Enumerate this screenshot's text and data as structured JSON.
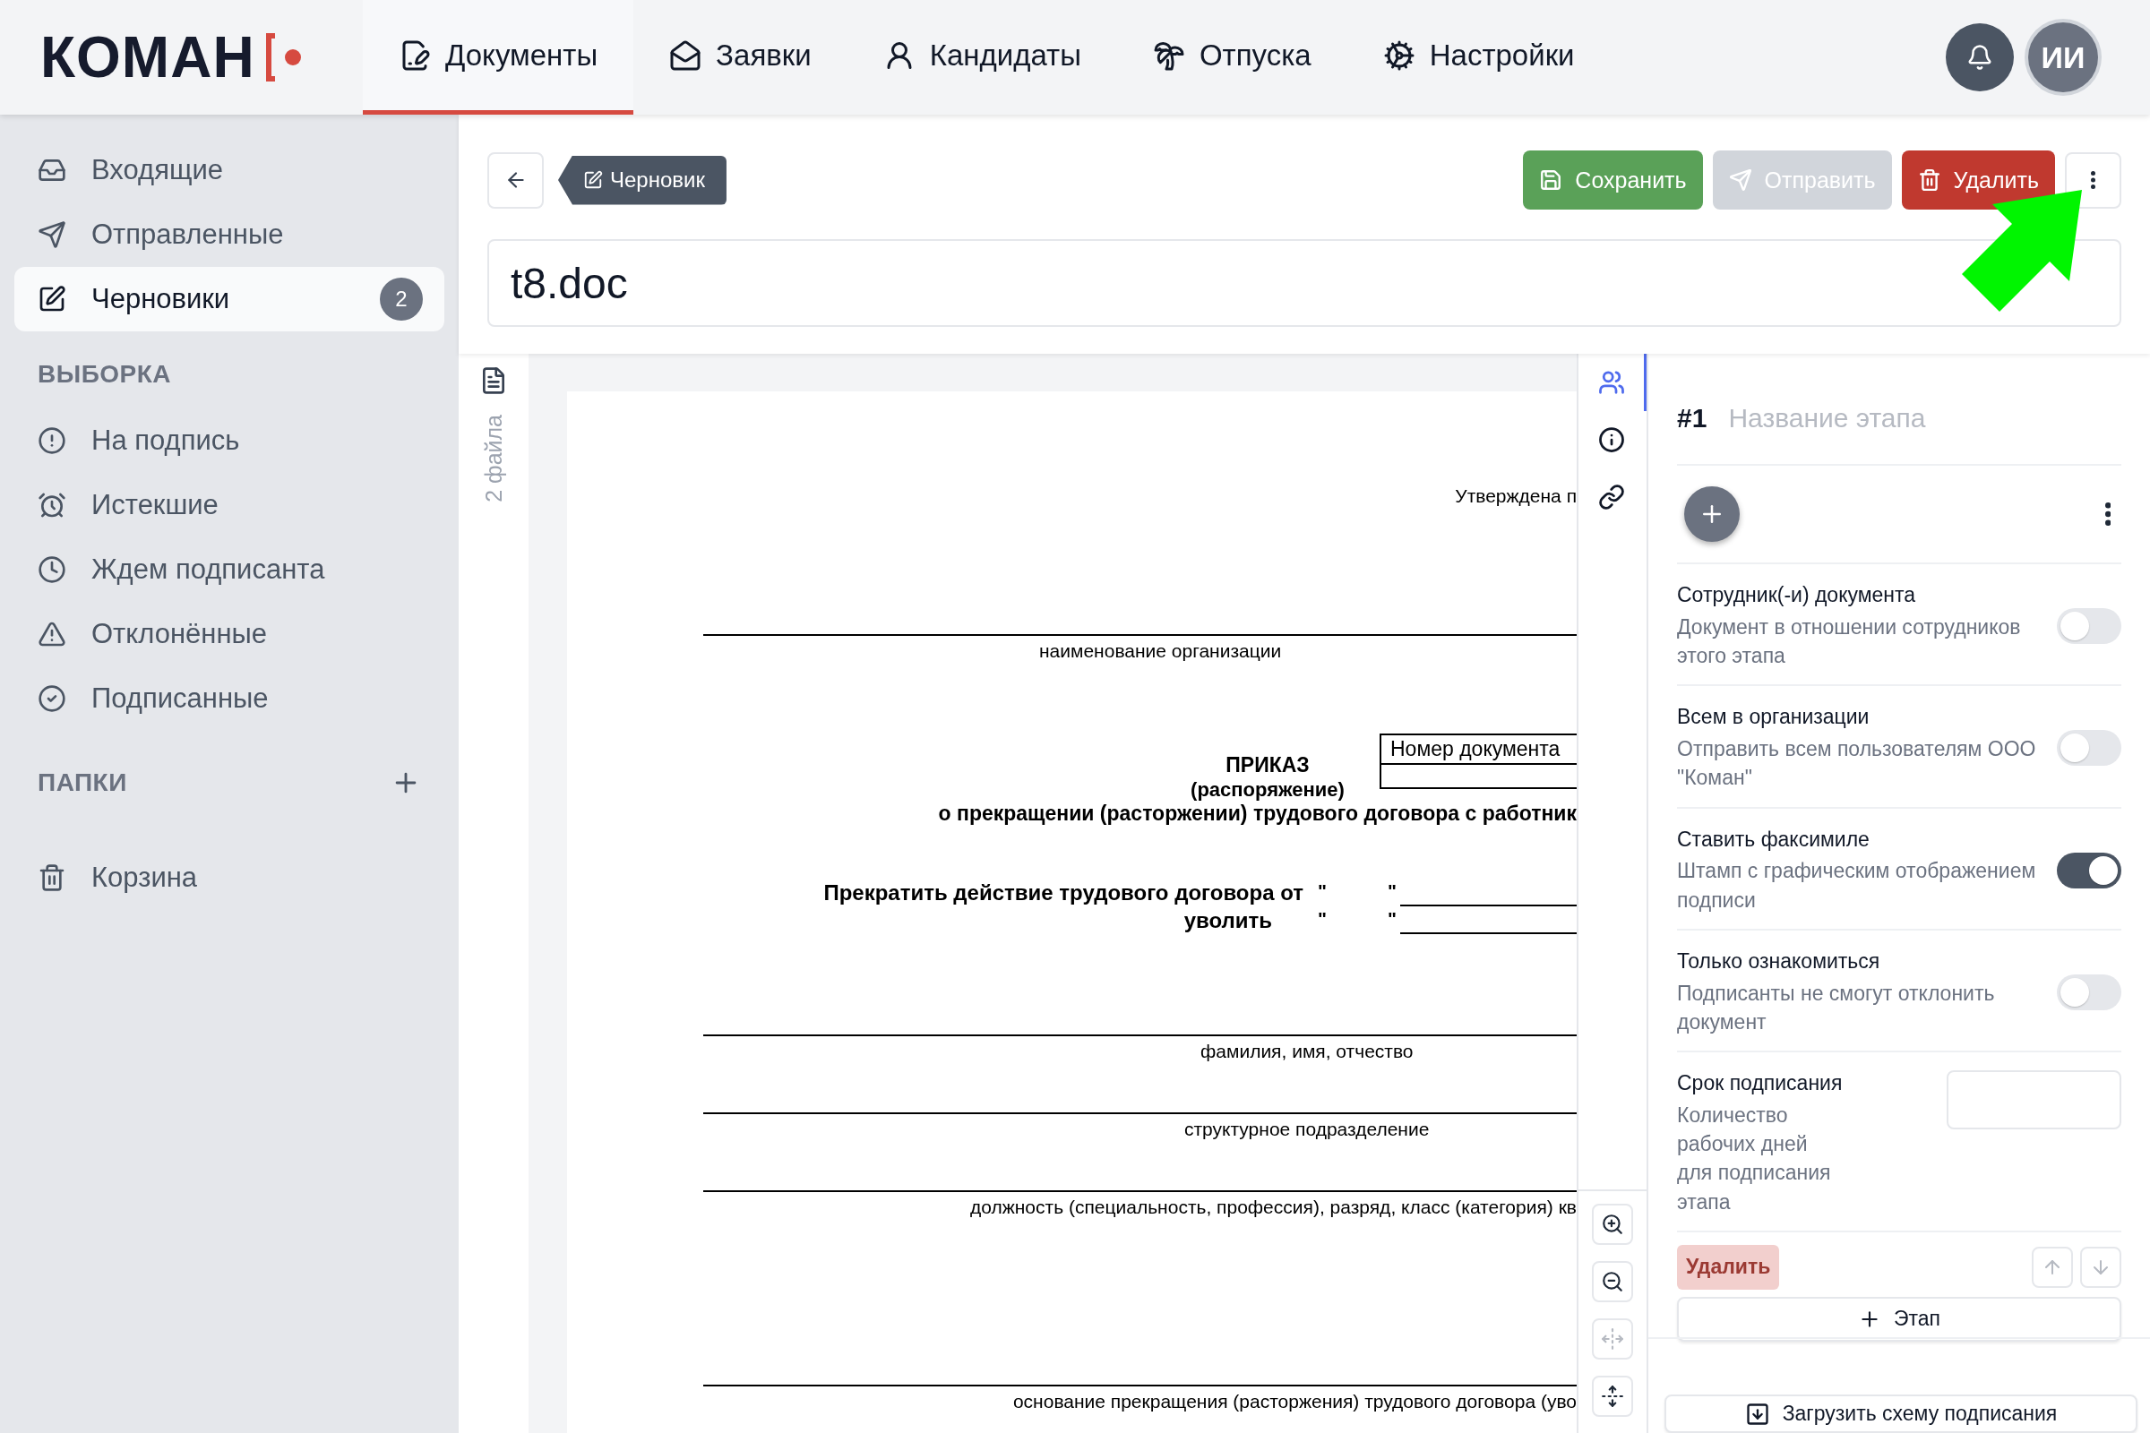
{
  "logo": {
    "text": "КОМАН"
  },
  "nav": [
    {
      "label": "Документы",
      "kind": "documents",
      "selected": true
    },
    {
      "label": "Заявки",
      "kind": "requests",
      "selected": false
    },
    {
      "label": "Кандидаты",
      "kind": "candidates",
      "selected": false
    },
    {
      "label": "Отпуска",
      "kind": "vacations",
      "selected": false
    },
    {
      "label": "Настройки",
      "kind": "settings",
      "selected": false
    }
  ],
  "user": {
    "initials": "ИИ"
  },
  "sidebar": {
    "items": [
      {
        "label": "Входящие",
        "kind": "inbox",
        "selected": false
      },
      {
        "label": "Отправленные",
        "kind": "sent",
        "selected": false
      },
      {
        "label": "Черновики",
        "kind": "drafts",
        "selected": true,
        "count": "2"
      }
    ],
    "filters_heading": "ВЫБОРКА",
    "filters": [
      {
        "label": "На подпись",
        "kind": "alert",
        "selected": false
      },
      {
        "label": "Истекшие",
        "kind": "alarm",
        "selected": false
      },
      {
        "label": "Ждем подписанта",
        "kind": "clock",
        "selected": false
      },
      {
        "label": "Отклонённые",
        "kind": "warning",
        "selected": false
      },
      {
        "label": "Подписанные",
        "kind": "check",
        "selected": false
      }
    ],
    "folders_heading": "ПАПКИ",
    "trash": {
      "label": "Корзина",
      "kind": "trash",
      "selected": false
    }
  },
  "header": {
    "status_badge": "Черновик",
    "buttons": [
      {
        "label": "Сохранить",
        "kind": "save",
        "disabled": false
      },
      {
        "label": "Отправить",
        "kind": "send",
        "disabled": true
      },
      {
        "label": "Удалить",
        "kind": "delete",
        "disabled": false
      }
    ],
    "title": "t8.doc"
  },
  "files": {
    "count_label": "2 файла"
  },
  "document": {
    "approved_note": "Утверждена п",
    "org_label": "наименование организации",
    "number_label": "Номер документа",
    "heading": "ПРИКАЗ",
    "subheading": "(распоряжение)",
    "subject": "о прекращении (расторжении) трудового договора с работник",
    "terminate_label": "Прекратить действие трудового договора от",
    "dismiss_label": "уволить",
    "quote_marks": [
      "\"",
      "\"",
      "\"",
      "\""
    ],
    "name_label": "фамилия, имя, отчество",
    "department_label": "структурное подразделение",
    "position_label": "должность (специальность, профессия), разряд, класс (категория) кв",
    "basis_label": "основание прекращения (расторжения) трудового договора (уво"
  },
  "side_tabs": [
    {
      "kind": "signers",
      "selected": true
    },
    {
      "kind": "info",
      "selected": false
    },
    {
      "kind": "links",
      "selected": false
    }
  ],
  "viewer_tools": [
    {
      "kind": "zoom_in",
      "disabled": false
    },
    {
      "kind": "zoom_out",
      "disabled": false
    },
    {
      "kind": "fit_width",
      "disabled": true
    },
    {
      "kind": "fit_height",
      "disabled": false
    }
  ],
  "stage": {
    "number": "#1",
    "name_placeholder": "Название этапа",
    "options": [
      {
        "title": "Сотрудник(-и) документа",
        "description": "Документ в отношении сотрудников этого этапа",
        "on": false
      },
      {
        "title": "Всем в организации",
        "description": "Отправить всем пользователям ООО \"Коман\"",
        "on": false
      },
      {
        "title": "Ставить факсимиле",
        "description": "Штамп с графическим отображением подписи",
        "on": true
      },
      {
        "title": "Только ознакомиться",
        "description": "Подписанты не смогут отклонить документ",
        "on": false
      }
    ],
    "deadline": {
      "title": "Срок подписания",
      "description": "Количество рабочих дней для подписания этапа"
    },
    "delete_button": {
      "label": "Удалить",
      "disabled": true
    },
    "add_stage_label": "Этап"
  },
  "load_scheme_label": "Загрузить схему подписания"
}
